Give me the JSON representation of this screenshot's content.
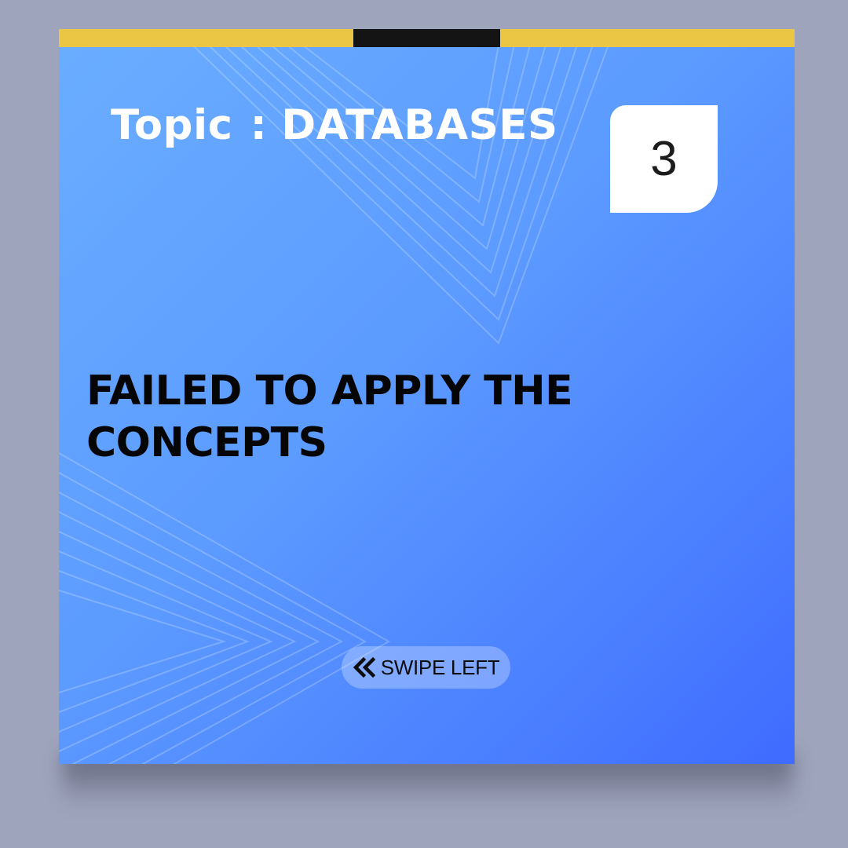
{
  "topic": {
    "prefix": "Topic",
    "separator": ":",
    "name": "DATABASES"
  },
  "slide_number": "3",
  "headline": "FAILED TO APPLY THE CONCEPTS",
  "swipe_button": {
    "label": "SWIPE LEFT",
    "icon": "double-chevron-left-icon"
  },
  "colors": {
    "page_background": "#9ea4bc",
    "card_gradient_start": "#6aaeff",
    "card_gradient_end": "#3f6bff",
    "top_bar_yellow": "#ebc644",
    "top_bar_active": "#141414",
    "headline": "#050505",
    "topic_text": "#ffffff"
  },
  "progress": {
    "total_segments": 5,
    "active_segment": 3
  }
}
